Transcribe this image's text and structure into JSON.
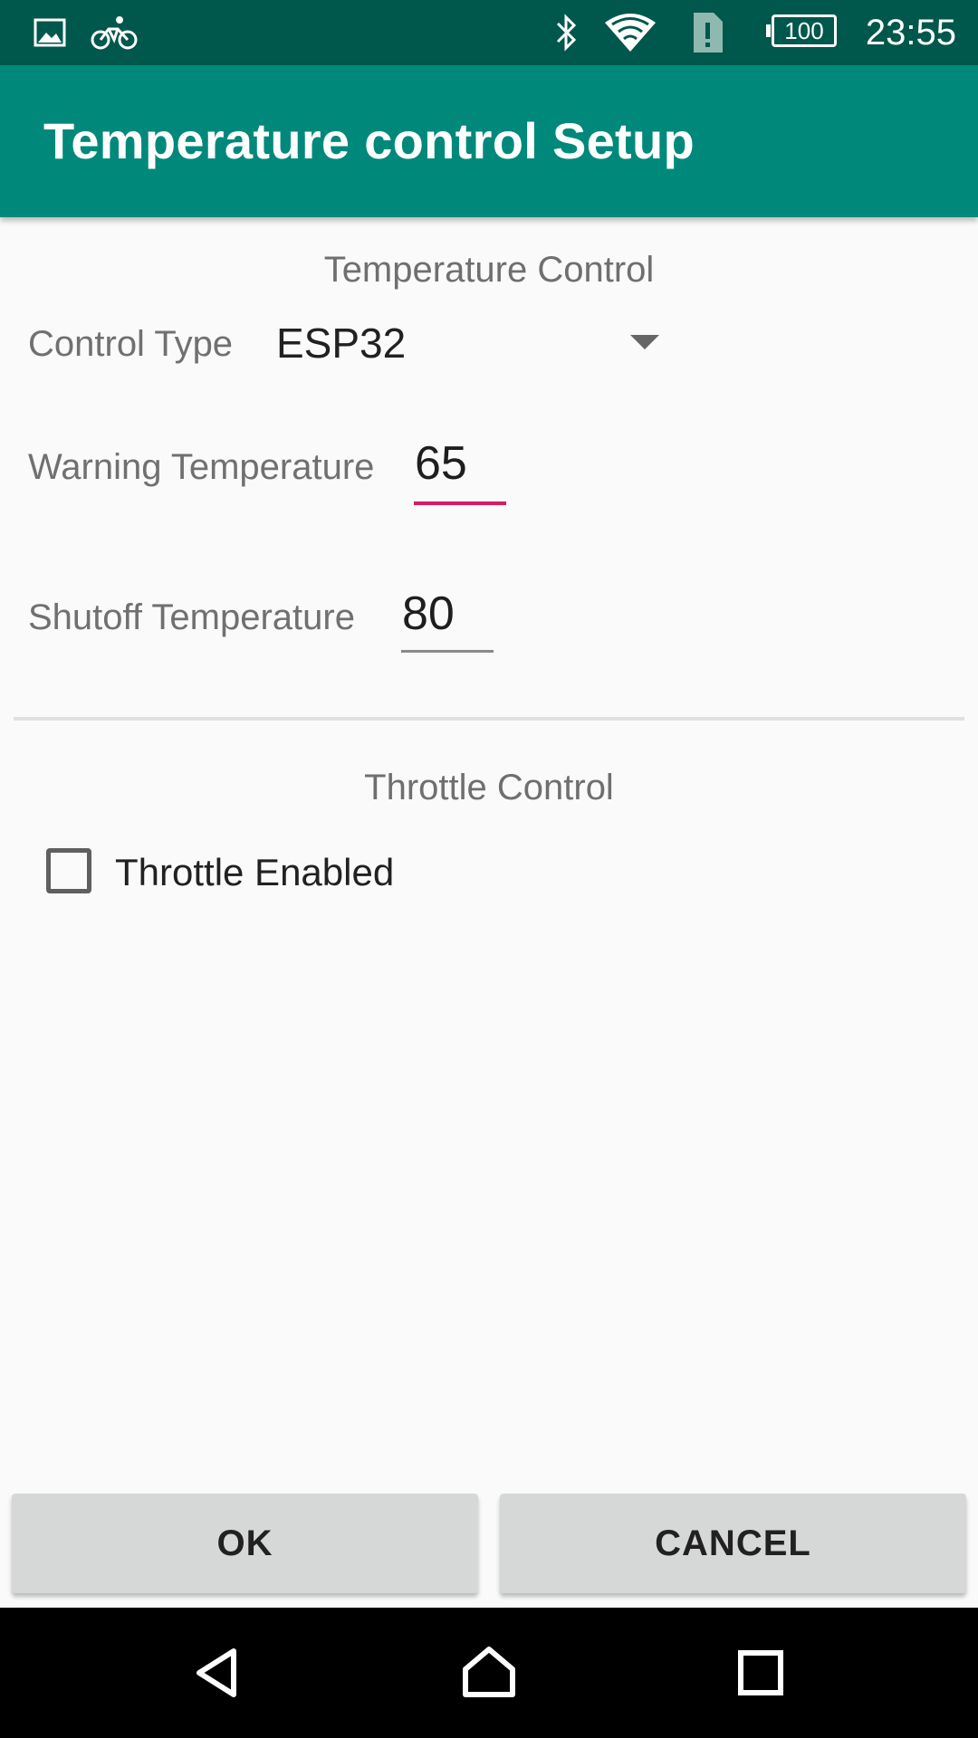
{
  "status_bar": {
    "icons": [
      "image-icon",
      "bike-icon",
      "bluetooth-icon",
      "wifi-icon",
      "sim-alert-icon",
      "battery-icon"
    ],
    "battery_level": "100",
    "time": "23:55",
    "background": "#00574b"
  },
  "app_bar": {
    "title": "Temperature control Setup",
    "background": "#00897b"
  },
  "temperature_section": {
    "title": "Temperature Control",
    "control_type": {
      "label": "Control Type",
      "value": "ESP32"
    },
    "warning_temperature": {
      "label": "Warning Temperature",
      "value": "65",
      "underline_color": "#d81b60"
    },
    "shutoff_temperature": {
      "label": "Shutoff Temperature",
      "value": "80"
    }
  },
  "throttle_section": {
    "title": "Throttle Control",
    "throttle_enabled": {
      "label": "Throttle Enabled",
      "checked": false
    }
  },
  "buttons": {
    "ok": "OK",
    "cancel": "CANCEL"
  },
  "nav_bar": {
    "icons": [
      "back-icon",
      "home-icon",
      "recents-icon"
    ]
  }
}
